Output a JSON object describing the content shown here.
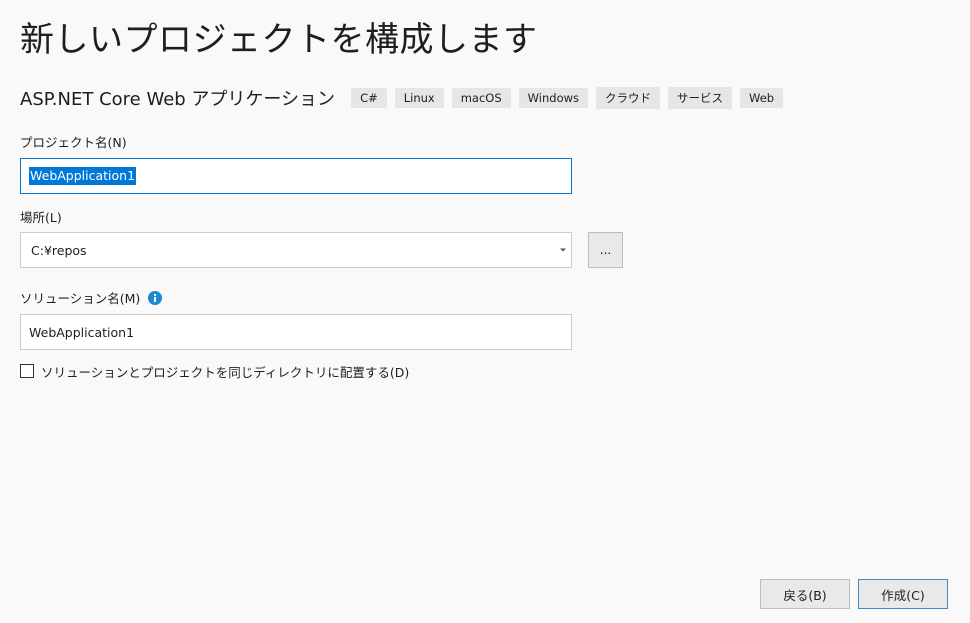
{
  "title": "新しいプロジェクトを構成します",
  "template": {
    "name": "ASP.NET Core Web アプリケーション",
    "tags": [
      "C#",
      "Linux",
      "macOS",
      "Windows",
      "クラウド",
      "サービス",
      "Web"
    ]
  },
  "project_name": {
    "label": "プロジェクト名(N)",
    "value": "WebApplication1"
  },
  "location": {
    "label": "場所(L)",
    "value": "C:¥repos",
    "browse_label": "..."
  },
  "solution_name": {
    "label": "ソリューション名(M)",
    "value": "WebApplication1"
  },
  "same_directory": {
    "label": "ソリューションとプロジェクトを同じディレクトリに配置する(D)",
    "checked": false
  },
  "buttons": {
    "back": "戻る(B)",
    "create": "作成(C)"
  },
  "colors": {
    "accent": "#007acc",
    "selection": "#0078d7",
    "info_icon": "#1a8ad4"
  }
}
